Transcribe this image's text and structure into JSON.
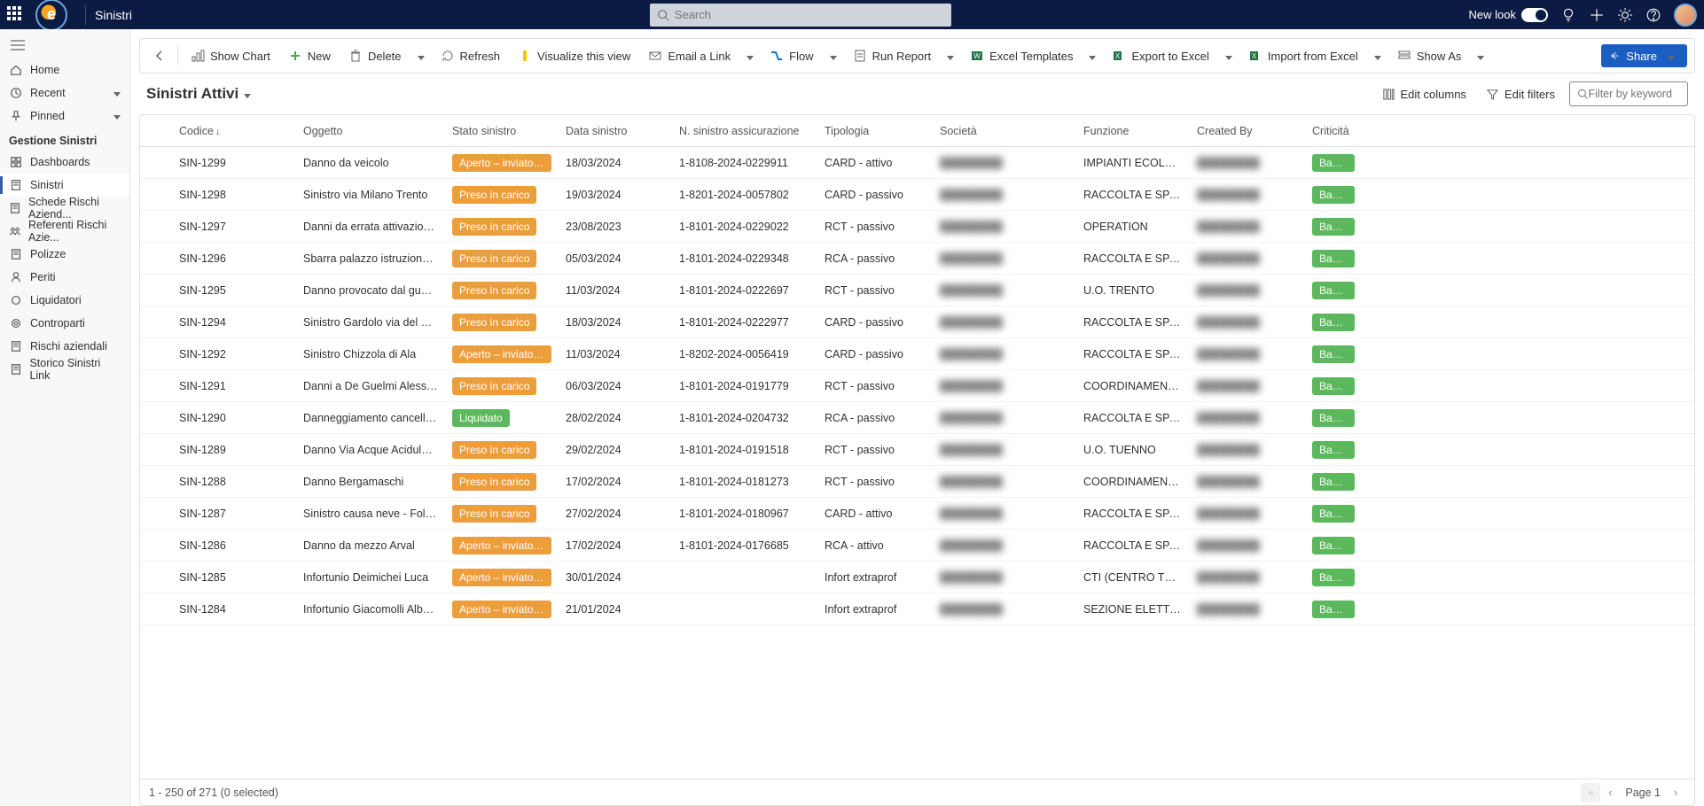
{
  "header": {
    "app_name": "Sinistri",
    "search_placeholder": "Search",
    "newlook_label": "New look"
  },
  "sidebar": {
    "top": [
      {
        "label": "Home",
        "icon": "home"
      },
      {
        "label": "Recent",
        "icon": "clock",
        "expand": true
      },
      {
        "label": "Pinned",
        "icon": "pin",
        "expand": true
      }
    ],
    "section_title": "Gestione Sinistri",
    "items": [
      {
        "label": "Dashboards",
        "icon": "dash"
      },
      {
        "label": "Sinistri",
        "icon": "doc",
        "active": true
      },
      {
        "label": "Schede Rischi Aziend...",
        "icon": "doc"
      },
      {
        "label": "Referenti Rischi Azie...",
        "icon": "people"
      },
      {
        "label": "Polizze",
        "icon": "doc"
      },
      {
        "label": "Periti",
        "icon": "person"
      },
      {
        "label": "Liquidatori",
        "icon": "circle"
      },
      {
        "label": "Controparti",
        "icon": "target"
      },
      {
        "label": "Rischi aziendali",
        "icon": "doc"
      },
      {
        "label": "Storico Sinistri Link",
        "icon": "doc"
      }
    ]
  },
  "commandbar": {
    "show_chart": "Show Chart",
    "new": "New",
    "delete": "Delete",
    "refresh": "Refresh",
    "visualize": "Visualize this view",
    "email": "Email a Link",
    "flow": "Flow",
    "run_report": "Run Report",
    "excel_templates": "Excel Templates",
    "export_excel": "Export to Excel",
    "import_excel": "Import from Excel",
    "show_as": "Show As",
    "share": "Share"
  },
  "view": {
    "title": "Sinistri Attivi",
    "edit_columns": "Edit columns",
    "edit_filters": "Edit filters",
    "filter_placeholder": "Filter by keyword"
  },
  "columns": {
    "code": "Codice",
    "oggetto": "Oggetto",
    "stato": "Stato sinistro",
    "data": "Data sinistro",
    "num": "N. sinistro assicurazione",
    "tip": "Tipologia",
    "soc": "Società",
    "fun": "Funzione",
    "created": "Created By",
    "crit": "Criticità"
  },
  "status_labels": {
    "aperto": "Aperto – inviato al Bro",
    "preso": "Preso in carico",
    "liquidato": "Liquidato"
  },
  "crit_label": "Bassa",
  "rows": [
    {
      "code": "SIN-1299",
      "oggetto": "Danno da veicolo",
      "stato": "aperto",
      "data": "18/03/2024",
      "num": "1-8108-2024-0229911",
      "tip": "CARD - attivo",
      "fun": "IMPIANTI ECOLOGICI"
    },
    {
      "code": "SIN-1298",
      "oggetto": "Sinistro via Milano Trento",
      "stato": "preso",
      "data": "19/03/2024",
      "num": "1-8201-2024-0057802",
      "tip": "CARD - passivo",
      "fun": "RACCOLTA E SPAZZA..."
    },
    {
      "code": "SIN-1297",
      "oggetto": "Danni da errata attivazione fo...",
      "stato": "preso",
      "data": "23/08/2023",
      "num": "1-8101-2024-0229022",
      "tip": "RCT - passivo",
      "fun": "OPERATION"
    },
    {
      "code": "SIN-1296",
      "oggetto": "Sbarra palazzo istruzione Rov...",
      "stato": "preso",
      "data": "05/03/2024",
      "num": "1-8101-2024-0229348",
      "tip": "RCA - passivo",
      "fun": "RACCOLTA E SPAZZA..."
    },
    {
      "code": "SIN-1295",
      "oggetto": "Danno provocato dal guasto s...",
      "stato": "preso",
      "data": "11/03/2024",
      "num": "1-8101-2024-0222697",
      "tip": "RCT - passivo",
      "fun": "U.O. TRENTO"
    },
    {
      "code": "SIN-1294",
      "oggetto": "Sinistro Gardolo via del Piopp...",
      "stato": "preso",
      "data": "18/03/2024",
      "num": "1-8101-2024-0222977",
      "tip": "CARD - passivo",
      "fun": "RACCOLTA E SPAZZA..."
    },
    {
      "code": "SIN-1292",
      "oggetto": "Sinistro Chizzola di Ala",
      "stato": "aperto",
      "data": "11/03/2024",
      "num": "1-8202-2024-0056419",
      "tip": "CARD - passivo",
      "fun": "RACCOLTA E SPAZZA..."
    },
    {
      "code": "SIN-1291",
      "oggetto": "Danni a De Guelmi Alessandro",
      "stato": "preso",
      "data": "06/03/2024",
      "num": "1-8101-2024-0191779",
      "tip": "RCT - passivo",
      "fun": "COORDINAMENTO U..."
    },
    {
      "code": "SIN-1290",
      "oggetto": "Danneggiamento cancello Be...",
      "stato": "liquidato",
      "data": "28/02/2024",
      "num": "1-8101-2024-0204732",
      "tip": "RCA - passivo",
      "fun": "RACCOLTA E SPAZZA..."
    },
    {
      "code": "SIN-1289",
      "oggetto": "Danno Via Acque Acidule Peio",
      "stato": "preso",
      "data": "29/02/2024",
      "num": "1-8101-2024-0191518",
      "tip": "RCT - passivo",
      "fun": "U.O. TUENNO"
    },
    {
      "code": "SIN-1288",
      "oggetto": "Danno Bergamaschi",
      "stato": "preso",
      "data": "17/02/2024",
      "num": "1-8101-2024-0181273",
      "tip": "RCT - passivo",
      "fun": "COORDINAMENTO U..."
    },
    {
      "code": "SIN-1287",
      "oggetto": "Sinistro causa neve - Folgaria",
      "stato": "preso",
      "data": "27/02/2024",
      "num": "1-8101-2024-0180967",
      "tip": "CARD - attivo",
      "fun": "RACCOLTA E SPAZZA..."
    },
    {
      "code": "SIN-1286",
      "oggetto": "Danno da mezzo Arval",
      "stato": "aperto",
      "data": "17/02/2024",
      "num": "1-8101-2024-0176685",
      "tip": "RCA - attivo",
      "fun": "RACCOLTA E SPAZZA..."
    },
    {
      "code": "SIN-1285",
      "oggetto": "Infortunio Deimichei Luca",
      "stato": "aperto",
      "data": "30/01/2024",
      "num": "",
      "tip": "Infort extraprof",
      "fun": "CTI (CENTRO TELECO..."
    },
    {
      "code": "SIN-1284",
      "oggetto": "Infortunio Giacomolli Alberto",
      "stato": "aperto",
      "data": "21/01/2024",
      "num": "",
      "tip": "Infort extraprof",
      "fun": "SEZIONE ELETTROME..."
    }
  ],
  "footer": {
    "range": "1 - 250 of 271 (0 selected)",
    "page": "Page 1"
  }
}
